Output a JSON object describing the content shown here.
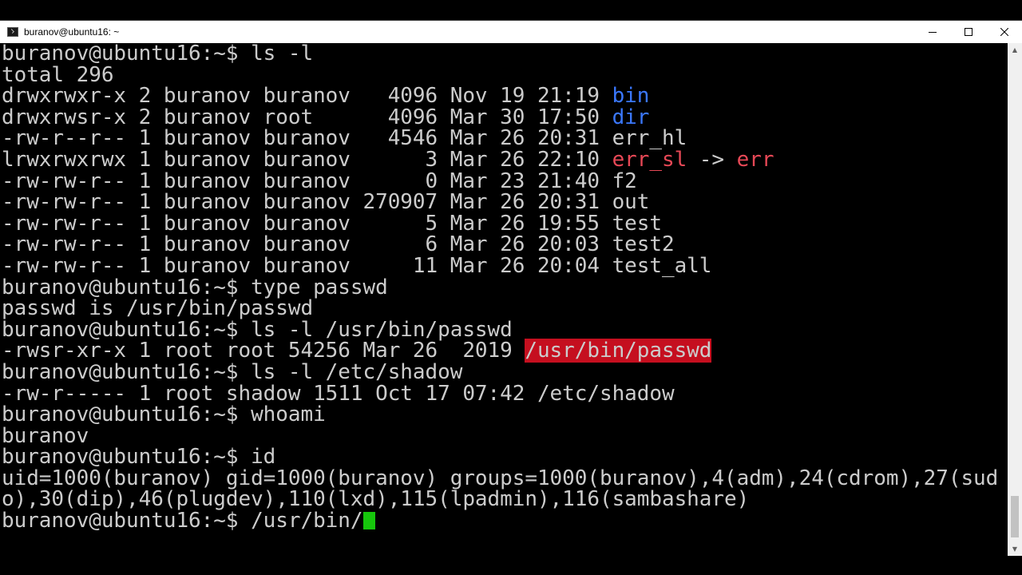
{
  "window": {
    "title": "buranov@ubuntu16: ~",
    "minimize_icon": "minimize-icon",
    "maximize_icon": "maximize-icon",
    "close_icon": "close-icon"
  },
  "colors": {
    "background": "#000000",
    "foreground": "#cccccc",
    "directory": "#3b78ff",
    "broken_link": "#e74856",
    "setuid_bg": "#c50f1f",
    "cursor": "#16c60c"
  },
  "terminal": {
    "lines": [
      [
        {
          "t": "buranov@ubuntu16:~$ ls -l"
        }
      ],
      [
        {
          "t": "total 296"
        }
      ],
      [
        {
          "t": "drwxrwxr-x 2 buranov buranov   4096 Nov 19 21:19 "
        },
        {
          "t": "bin",
          "c": "c-blue"
        }
      ],
      [
        {
          "t": "drwxrwsr-x 2 buranov root      4096 Mar 30 17:50 "
        },
        {
          "t": "dir",
          "c": "c-blue"
        }
      ],
      [
        {
          "t": "-rw-r--r-- 1 buranov buranov   4546 Mar 26 20:31 err_hl"
        }
      ],
      [
        {
          "t": "lrwxrwxrwx 1 buranov buranov      3 Mar 26 22:10 "
        },
        {
          "t": "err_sl",
          "c": "c-red"
        },
        {
          "t": " -> "
        },
        {
          "t": "err",
          "c": "c-red"
        }
      ],
      [
        {
          "t": "-rw-rw-r-- 1 buranov buranov      0 Mar 23 21:40 f2"
        }
      ],
      [
        {
          "t": "-rw-rw-r-- 1 buranov buranov 270907 Mar 26 20:31 out"
        }
      ],
      [
        {
          "t": "-rw-rw-r-- 1 buranov buranov      5 Mar 26 19:55 test"
        }
      ],
      [
        {
          "t": "-rw-rw-r-- 1 buranov buranov      6 Mar 26 20:03 test2"
        }
      ],
      [
        {
          "t": "-rw-rw-r-- 1 buranov buranov     11 Mar 26 20:04 test_all"
        }
      ],
      [
        {
          "t": "buranov@ubuntu16:~$ type passwd"
        }
      ],
      [
        {
          "t": "passwd is /usr/bin/passwd"
        }
      ],
      [
        {
          "t": "buranov@ubuntu16:~$ ls -l /usr/bin/passwd"
        }
      ],
      [
        {
          "t": "-rwsr-xr-x 1 root root 54256 Mar 26  2019 "
        },
        {
          "t": "/usr/bin/passwd",
          "c": "c-redbg"
        }
      ],
      [
        {
          "t": "buranov@ubuntu16:~$ ls -l /etc/shadow"
        }
      ],
      [
        {
          "t": "-rw-r----- 1 root shadow 1511 Oct 17 07:42 /etc/shadow"
        }
      ],
      [
        {
          "t": "buranov@ubuntu16:~$ whoami"
        }
      ],
      [
        {
          "t": "buranov"
        }
      ],
      [
        {
          "t": "buranov@ubuntu16:~$ id"
        }
      ],
      [
        {
          "t": "uid=1000(buranov) gid=1000(buranov) groups=1000(buranov),4(adm),24(cdrom),27(sud"
        }
      ],
      [
        {
          "t": "o),30(dip),46(plugdev),110(lxd),115(lpadmin),116(sambashare)"
        }
      ],
      [
        {
          "t": "buranov@ubuntu16:~$ /usr/bin/"
        },
        {
          "cursor": true
        }
      ]
    ]
  }
}
